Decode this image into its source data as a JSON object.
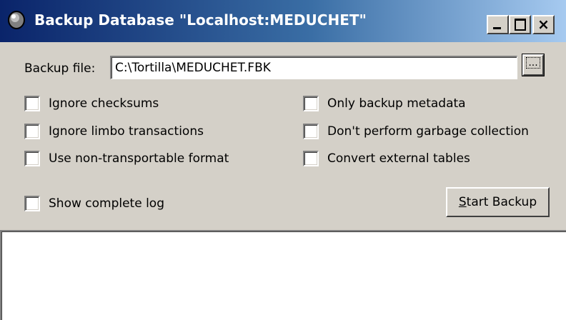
{
  "window": {
    "title": "Backup Database \"Localhost:MEDUCHET\"",
    "icon": "database-icon",
    "controls": {
      "minimize": "minimize-icon",
      "maximize": "maximize-icon",
      "close": "×"
    }
  },
  "backup_file": {
    "label": "Backup file:",
    "value": "C:\\Tortilla\\MEDUCHET.FBK",
    "browse_label": "..."
  },
  "options": {
    "left": [
      {
        "label": "Ignore checksums",
        "checked": false
      },
      {
        "label": "Ignore limbo transactions",
        "checked": false
      },
      {
        "label": "Use non-transportable format",
        "checked": false
      }
    ],
    "right": [
      {
        "label": "Only backup metadata",
        "checked": false
      },
      {
        "label": "Don't perform garbage collection",
        "checked": false
      },
      {
        "label": "Convert external tables",
        "checked": false
      }
    ]
  },
  "show_log": {
    "label": "Show complete log",
    "checked": false
  },
  "start_button": {
    "underlined": "S",
    "rest": "tart Backup"
  },
  "log": {
    "text": ""
  },
  "colors": {
    "titlebar_start": "#0a246a",
    "titlebar_end": "#a6caf0",
    "face": "#d4d0c8"
  }
}
